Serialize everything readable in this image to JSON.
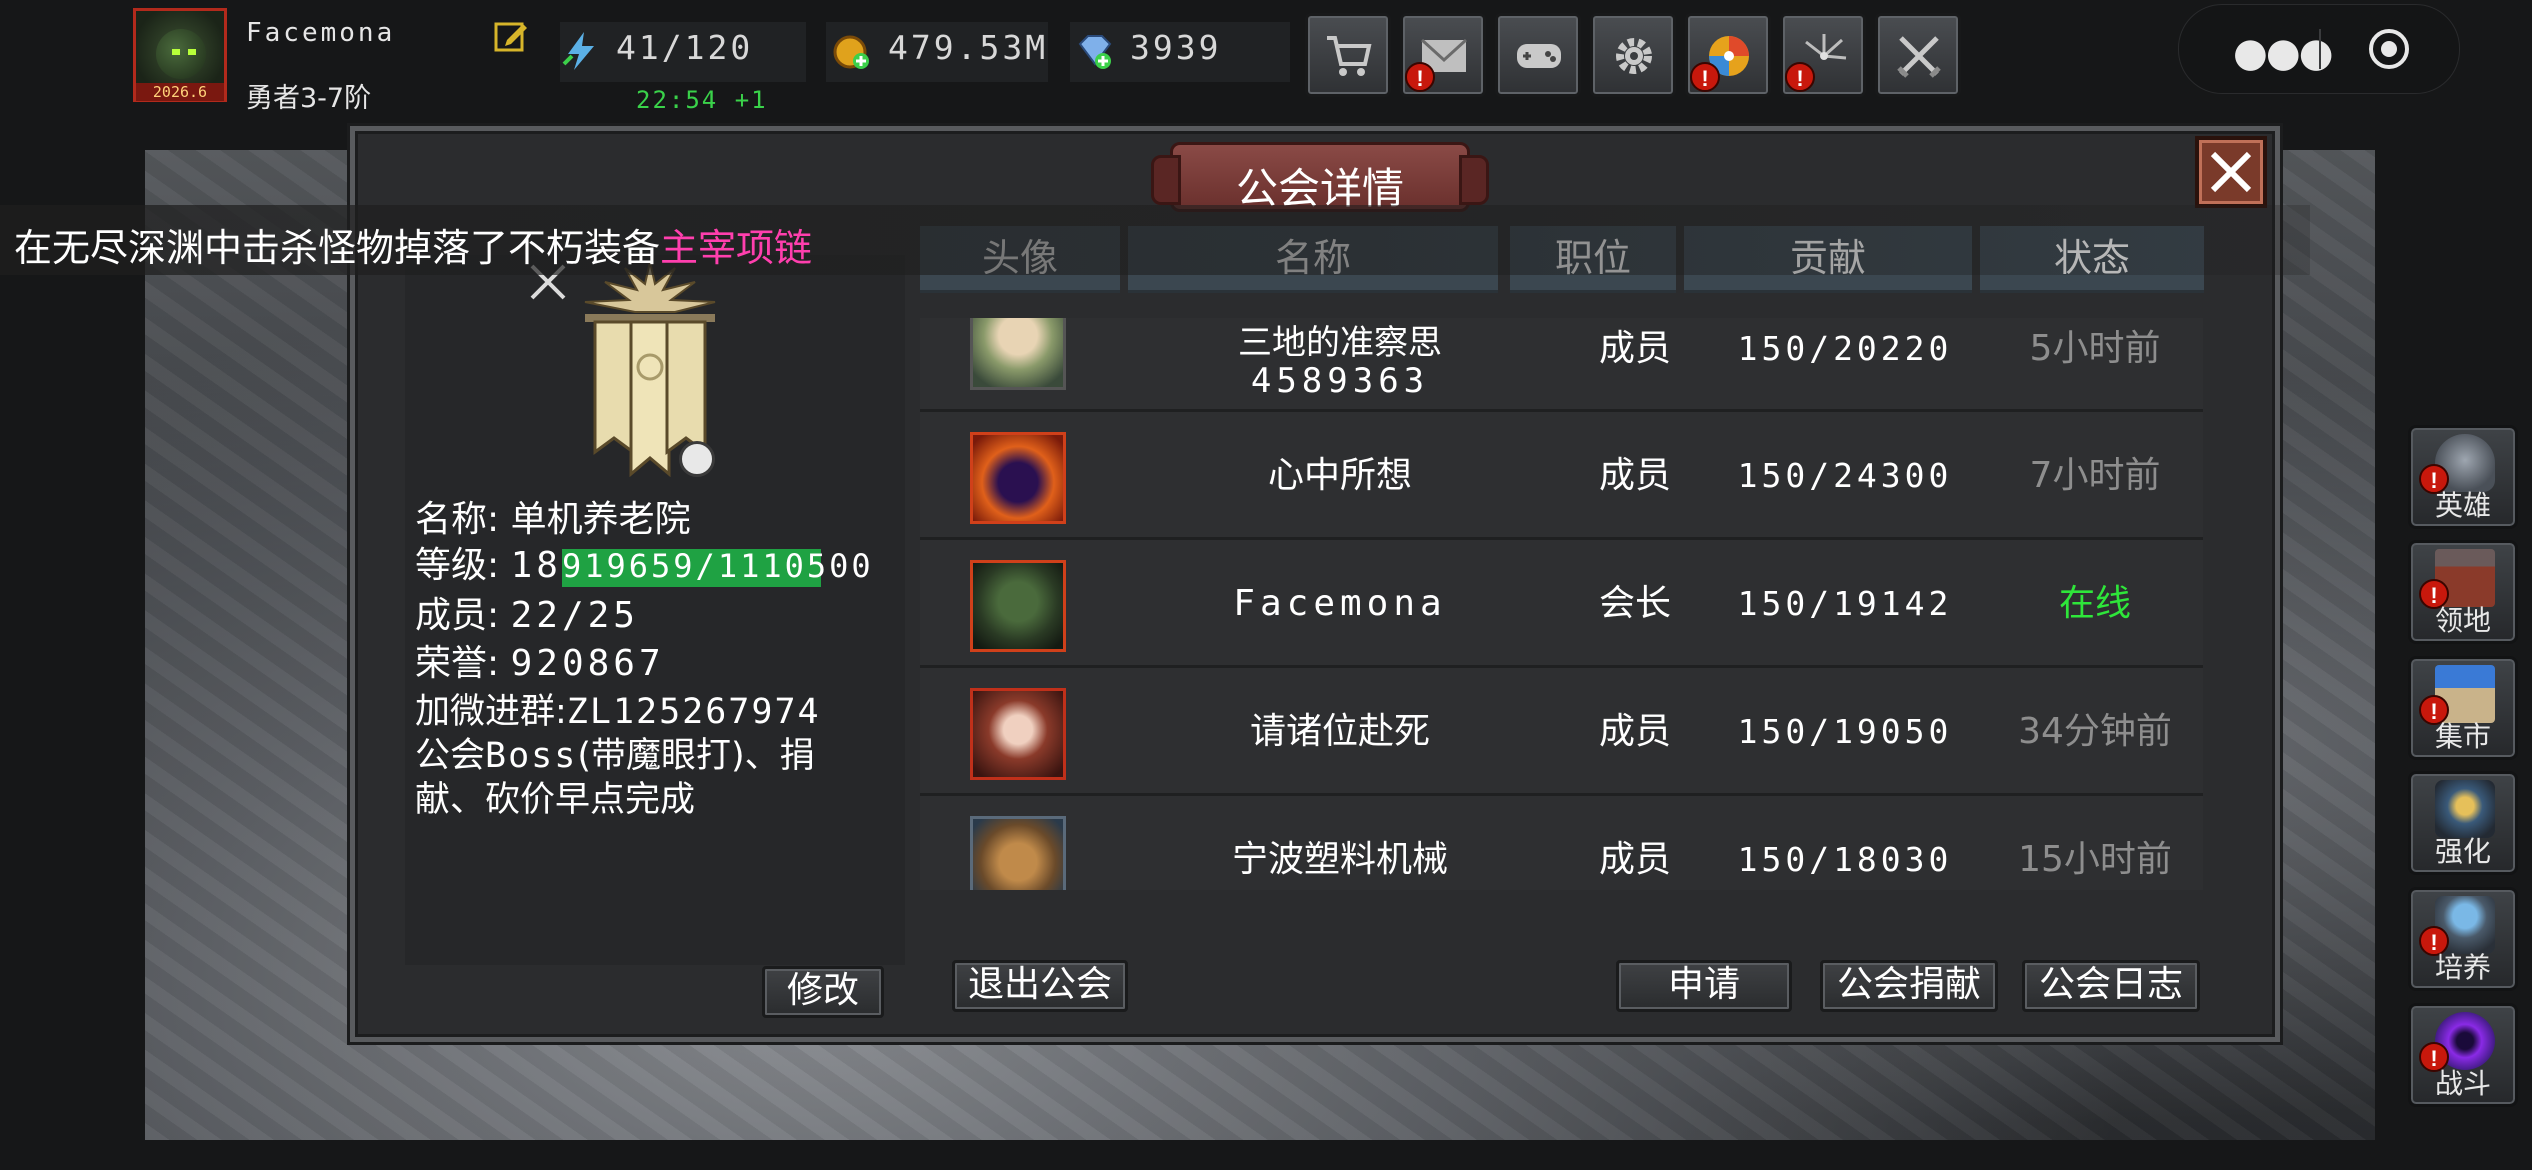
{
  "player": {
    "name": "Facemona",
    "rank": "勇者3-7阶",
    "avatar_badge": "2026.6"
  },
  "resources": {
    "stamina": "41/120",
    "stamina_timer": "22:54 +1",
    "gold": "479.53M",
    "gems": "3939"
  },
  "top_buttons": [
    {
      "icon": "cart-icon",
      "alert": false
    },
    {
      "icon": "mail-icon",
      "alert": true
    },
    {
      "icon": "gamepad-icon",
      "alert": false
    },
    {
      "icon": "gear-icon",
      "alert": false
    },
    {
      "icon": "wheel-icon",
      "alert": true
    },
    {
      "icon": "fireworks-icon",
      "alert": true
    },
    {
      "icon": "swords-icon",
      "alert": false
    }
  ],
  "alert_mark": "!",
  "capsule": {
    "more_icon": "more-dots-icon",
    "close_icon": "target-circle-icon"
  },
  "marquee": {
    "text": "在无尽深渊中击杀怪物掉落了不朽装备",
    "item": "主宰项链",
    "item_color": "#ff3fae"
  },
  "dialog": {
    "title": "公会详情",
    "guild": {
      "name_label": "名称:",
      "name": "单机养老院",
      "level_label": "等级:",
      "level": "18",
      "xp": "919659/1110500",
      "xp_progress": 0.83,
      "members_label": "成员:",
      "members": "22/25",
      "honor_label": "荣誉:",
      "honor": "920867",
      "notice_prefix": "加微进群:",
      "notice_code": "ZL125267974",
      "notice_line2_a": "公会",
      "notice_line2_b": "Boss",
      "notice_line2_c": "(带魔眼打)、捐",
      "notice_line3": "献、砍价早点完成"
    },
    "columns": [
      "头像",
      "名称",
      "职位",
      "贡献",
      "状态"
    ],
    "members": [
      {
        "name_line1": "三地的准察思",
        "name_line2": "4589363",
        "role": "成员",
        "contribution": "150/20220",
        "status": "5小时前",
        "online": false,
        "avatar": "elf-avatar-icon"
      },
      {
        "name": "心中所想",
        "role": "成员",
        "contribution": "150/24300",
        "status": "7小时前",
        "online": false,
        "avatar": "demon-avatar-icon"
      },
      {
        "name": "Facemona",
        "role": "会长",
        "contribution": "150/19142",
        "status": "在线",
        "online": true,
        "avatar": "goblin-avatar-icon"
      },
      {
        "name": "请诸位赴死",
        "role": "成员",
        "contribution": "150/19050",
        "status": "34分钟前",
        "online": false,
        "avatar": "fox-mask-girl-avatar-icon"
      },
      {
        "name": "宁波塑料机械",
        "role": "成员",
        "contribution": "150/18030",
        "status": "15小时前",
        "online": false,
        "avatar": "golem-avatar-icon"
      }
    ],
    "buttons": {
      "modify": "修改",
      "leave": "退出公会",
      "apply": "申请",
      "donate": "公会捐献",
      "log": "公会日志"
    }
  },
  "side_menu": [
    {
      "label": "英雄",
      "icon": "helmet-icon",
      "alert": true
    },
    {
      "label": "领地",
      "icon": "castle-icon",
      "alert": true
    },
    {
      "label": "集市",
      "icon": "market-icon",
      "alert": true
    },
    {
      "label": "强化",
      "icon": "crystal-icon",
      "alert": false
    },
    {
      "label": "培养",
      "icon": "chalice-icon",
      "alert": true
    },
    {
      "label": "战斗",
      "icon": "portal-icon",
      "alert": true
    }
  ],
  "colors": {
    "online": "#2ee63a",
    "offline": "#8e8e8e",
    "xp_bar": "#1fa243",
    "timer": "#3ad24a",
    "alert": "#c8180c",
    "header_bg": "#3b4750"
  }
}
